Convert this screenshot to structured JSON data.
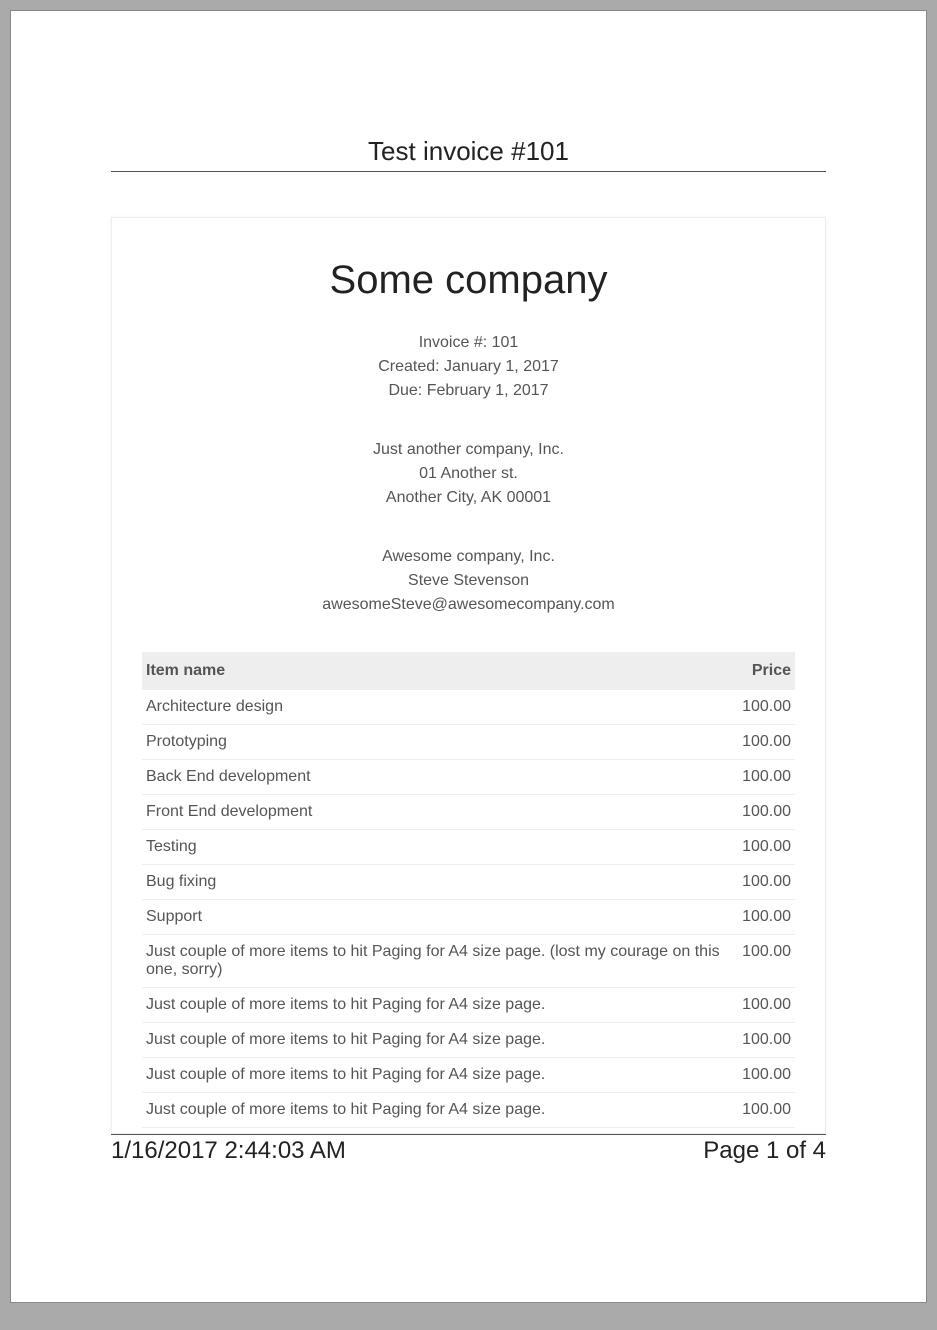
{
  "header": {
    "title": "Test invoice #101"
  },
  "invoice": {
    "company_name": "Some company",
    "invoice_number_line": "Invoice #: 101",
    "created_line": "Created: January 1, 2017",
    "due_line": "Due: February 1, 2017",
    "from": {
      "line1": "Just another company, Inc.",
      "line2": "01 Another st.",
      "line3": "Another City, AK 00001"
    },
    "to": {
      "line1": "Awesome company, Inc.",
      "line2": "Steve Stevenson",
      "line3": "awesomeSteve@awesomecompany.com"
    }
  },
  "table": {
    "columns": {
      "item": "Item name",
      "price": "Price"
    },
    "rows": [
      {
        "item": "Architecture design",
        "price": "100.00"
      },
      {
        "item": "Prototyping",
        "price": "100.00"
      },
      {
        "item": "Back End development",
        "price": "100.00"
      },
      {
        "item": "Front End development",
        "price": "100.00"
      },
      {
        "item": "Testing",
        "price": "100.00"
      },
      {
        "item": "Bug fixing",
        "price": "100.00"
      },
      {
        "item": "Support",
        "price": "100.00"
      },
      {
        "item": "Just couple of more items to hit Paging for A4 size page. (lost my courage on this one, sorry)",
        "price": "100.00"
      },
      {
        "item": "Just couple of more items to hit Paging for A4 size page.",
        "price": "100.00"
      },
      {
        "item": "Just couple of more items to hit Paging for A4 size page.",
        "price": "100.00"
      },
      {
        "item": "Just couple of more items to hit Paging for A4 size page.",
        "price": "100.00"
      },
      {
        "item": "Just couple of more items to hit Paging for A4 size page.",
        "price": "100.00"
      }
    ]
  },
  "footer": {
    "timestamp": "1/16/2017 2:44:03 AM",
    "page_label": "Page 1 of 4"
  }
}
